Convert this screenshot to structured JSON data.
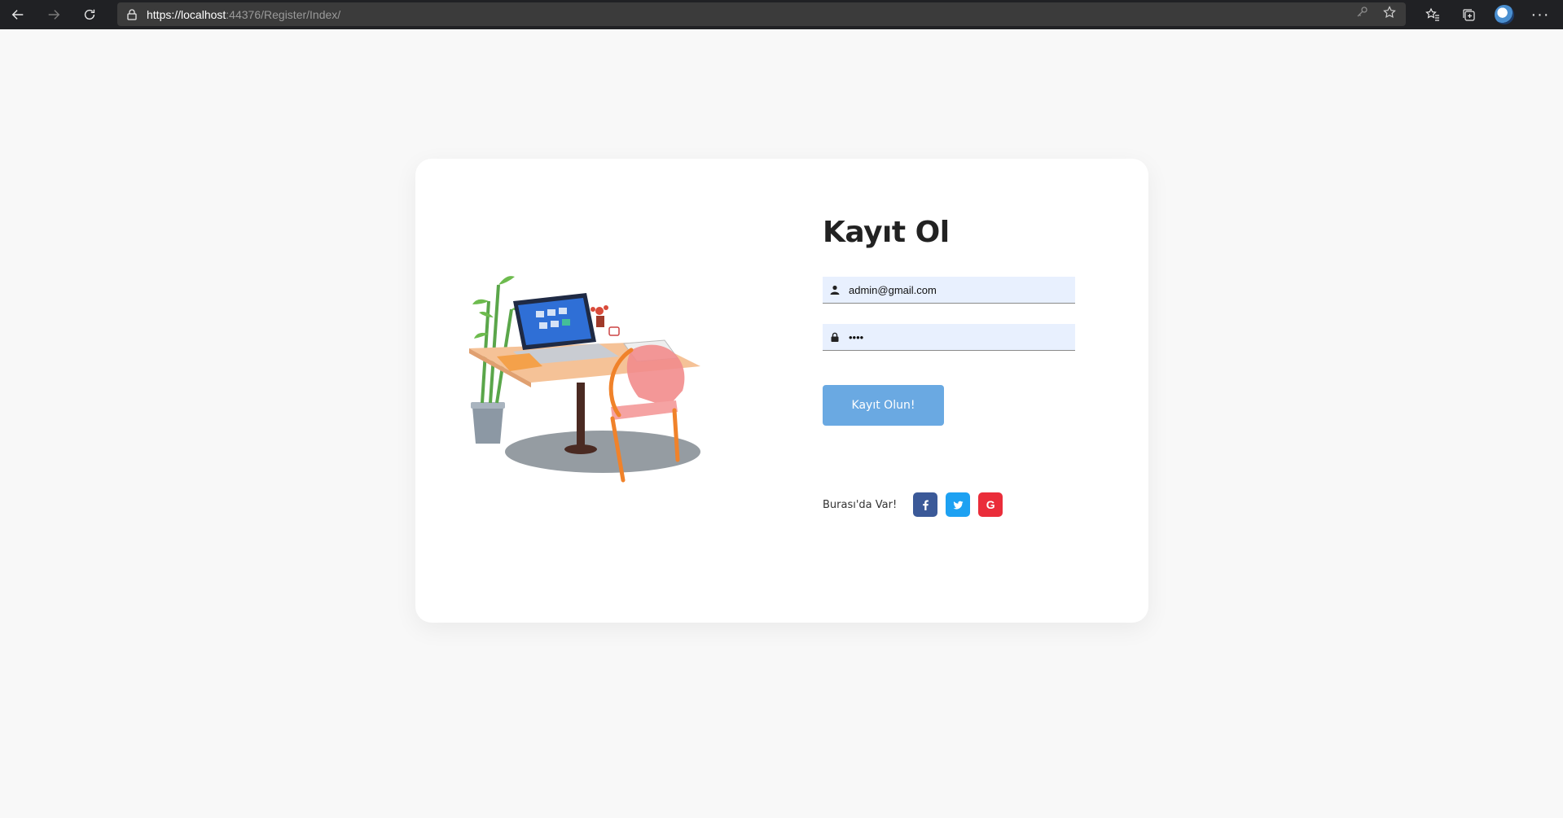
{
  "browser": {
    "url_prefix": "https://",
    "url_host": "localhost",
    "url_rest": ":44376/Register/Index/"
  },
  "register": {
    "title": "Kayıt Ol",
    "email_value": "admin@gmail.com",
    "password_value": "1234",
    "submit_label": "Kayıt Olun!",
    "social_label": "Burası'da Var!",
    "google_letter": "G"
  },
  "icons": {
    "email": "user-icon",
    "password": "lock-icon",
    "facebook": "facebook-icon",
    "twitter": "twitter-icon",
    "google": "google-icon"
  },
  "colors": {
    "submit_bg": "#6aa9e2",
    "facebook": "#3b5998",
    "twitter": "#1da1f2",
    "google": "#ea2d3a",
    "input_bg": "#e8f0fe"
  }
}
